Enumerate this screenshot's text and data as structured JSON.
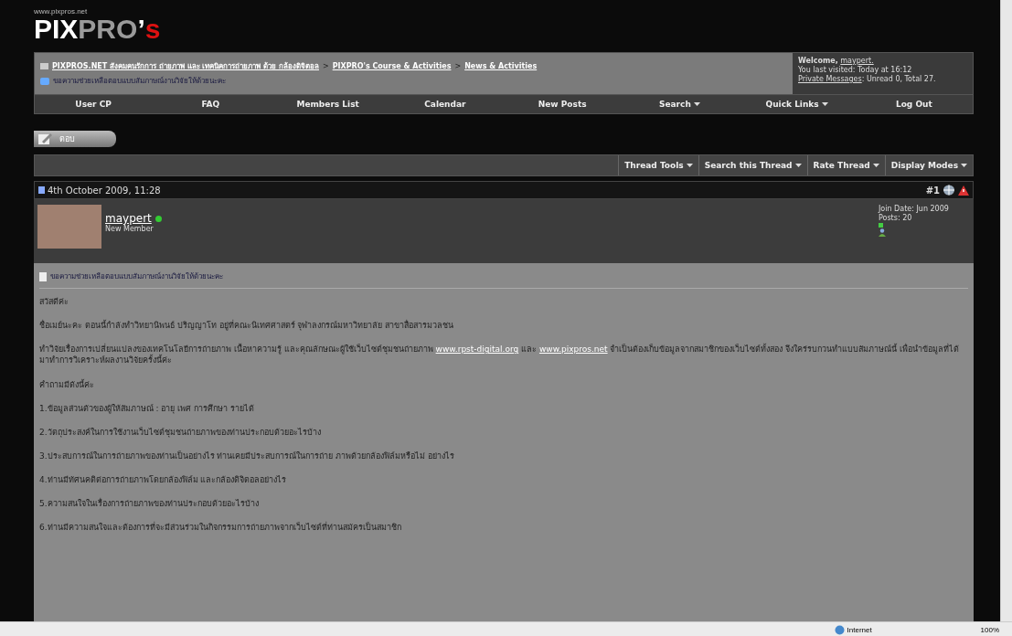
{
  "logo": {
    "url": "www.pixpros.net",
    "parts": [
      "PIX",
      "PRO",
      "’",
      "s"
    ]
  },
  "breadcrumb": {
    "links": [
      "PIXPROS.NET สังคมคนรักการ ถ่ายภาพ และ เทคนิคการถ่ายภาพ ด้วย กล้องดิจิตอล",
      "PIXPRO's Course & Activities",
      "News & Activities"
    ],
    "separator": ">",
    "current": "ขอความช่วยเหลือตอบแบบสัมภาษณ์งานวิจัยให้ด้วยนะคะ"
  },
  "welcome": {
    "greeting": "Welcome,",
    "user": "maypert.",
    "last_visit": "You last visited: Today at 16:12",
    "pm_link": "Private Messages",
    "pm_counts": ": Unread 0, Total 27."
  },
  "navbar": [
    {
      "label": "User CP",
      "dropdown": false
    },
    {
      "label": "FAQ",
      "dropdown": false
    },
    {
      "label": "Members List",
      "dropdown": false
    },
    {
      "label": "Calendar",
      "dropdown": false
    },
    {
      "label": "New Posts",
      "dropdown": false
    },
    {
      "label": "Search",
      "dropdown": true
    },
    {
      "label": "Quick Links",
      "dropdown": true
    },
    {
      "label": "Log Out",
      "dropdown": false
    }
  ],
  "reply_button": "ตอบ",
  "thread_tools": [
    {
      "label": "Thread Tools",
      "dropdown": true
    },
    {
      "label": "Search this Thread",
      "dropdown": true
    },
    {
      "label": "Rate Thread",
      "dropdown": true
    },
    {
      "label": "Display Modes",
      "dropdown": true
    }
  ],
  "post": {
    "date": "4th October 2009, 11:28",
    "number": "#1",
    "username": "maypert",
    "online": true,
    "user_title": "New Member",
    "join_date": "Join Date: Jun 2009",
    "posts": "Posts: 20",
    "title": "ขอความช่วยเหลือตอบแบบสัมภาษณ์งานวิจัยให้ด้วยนะคะ",
    "paragraphs": [
      [
        {
          "text": "สวัสดีค่ะ",
          "link": false
        }
      ],
      [
        {
          "text": "ชื่อเมย์นะคะ ตอนนี้กำลังทำวิทยานิพนธ์ ปริญญาโท อยู่ที่คณะนิเทศศาสตร์ จุฬาลงกรณ์มหาวิทยาลัย สาขาสื่อสารมวลชน",
          "link": false
        }
      ],
      [
        {
          "text": "ทำวิจัยเรื่องการเปลี่ยนแปลงของเทคโนโลยีการถ่ายภาพ เนื้อหาความรู้ และคุณลักษณะผู้ใช้เว็บไซต์ชุมชนถ่ายภาพ ",
          "link": false
        },
        {
          "text": "www.rpst-digital.org",
          "link": true
        },
        {
          "text": " และ ",
          "link": false
        },
        {
          "text": "www.pixpros.net",
          "link": true
        },
        {
          "text": " จำเป็นต้องเก็บข้อมูลจากสมาชิกของเว็บไซต์ทั้งสอง จึงใคร่รบกวนทำแบบสัมภาษณ์นี้ เพื่อนำข้อมูลที่ได้มาทำการวิเคราะห์ผลงานวิจัยครั้งนี้ค่ะ",
          "link": false
        }
      ],
      [
        {
          "text": "คำถามมีดังนี้ค่ะ",
          "link": false
        }
      ],
      [
        {
          "text": "1.ข้อมูลส่วนตัวของผู้ให้สัมภาษณ์ : อายุ เพศ การศึกษา รายได้",
          "link": false
        }
      ],
      [
        {
          "text": "2.วัตถุประสงค์ในการใช้งานเว็บไซต์ชุมชนถ่ายภาพของท่านประกอบด้วยอะไรบ้าง",
          "link": false
        }
      ],
      [
        {
          "text": "3.ประสบการณ์ในการถ่ายภาพของท่านเป็นอย่างไร ท่านเคยมีประสบการณ์ในการถ่าย ภาพด้วยกล้องฟิล์มหรือไม่ อย่างไร",
          "link": false
        }
      ],
      [
        {
          "text": "4.ท่านมีทัศนคติต่อการถ่ายภาพโดยกล้องฟิล์ม และกล้องดิจิตอลอย่างไร",
          "link": false
        }
      ],
      [
        {
          "text": "5.ความสนใจในเรื่องการถ่ายภาพของท่านประกอบด้วยอะไรบ้าง",
          "link": false
        }
      ],
      [
        {
          "text": "6.ท่านมีความสนใจและต้องการที่จะมีส่วนร่วมในกิจกรรมการถ่ายภาพจากเว็บไซต์ที่ท่านสมัครเป็นสมาชิก",
          "link": false
        }
      ]
    ]
  },
  "status_bar": {
    "zone": "Internet",
    "zoom": "100%"
  }
}
